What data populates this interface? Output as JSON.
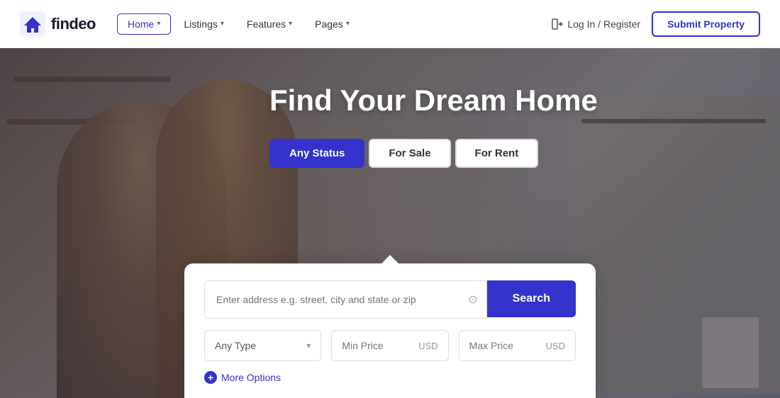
{
  "navbar": {
    "logo_text": "findeo",
    "nav_items": [
      {
        "label": "Home",
        "active": true,
        "has_chevron": true
      },
      {
        "label": "Listings",
        "active": false,
        "has_chevron": true
      },
      {
        "label": "Features",
        "active": false,
        "has_chevron": true
      },
      {
        "label": "Pages",
        "active": false,
        "has_chevron": true
      }
    ],
    "login_label": "Log In / Register",
    "submit_label": "Submit Property"
  },
  "hero": {
    "title": "Find Your Dream Home",
    "status_tabs": [
      {
        "label": "Any Status",
        "active": true
      },
      {
        "label": "For Sale",
        "active": false
      },
      {
        "label": "For Rent",
        "active": false
      }
    ]
  },
  "search": {
    "input_placeholder": "Enter address e.g. street, city and state or zip",
    "search_button_label": "Search",
    "type_placeholder": "Any Type",
    "min_price_placeholder": "Min Price",
    "max_price_placeholder": "Max Price",
    "currency_label": "USD",
    "more_options_label": "More Options"
  }
}
